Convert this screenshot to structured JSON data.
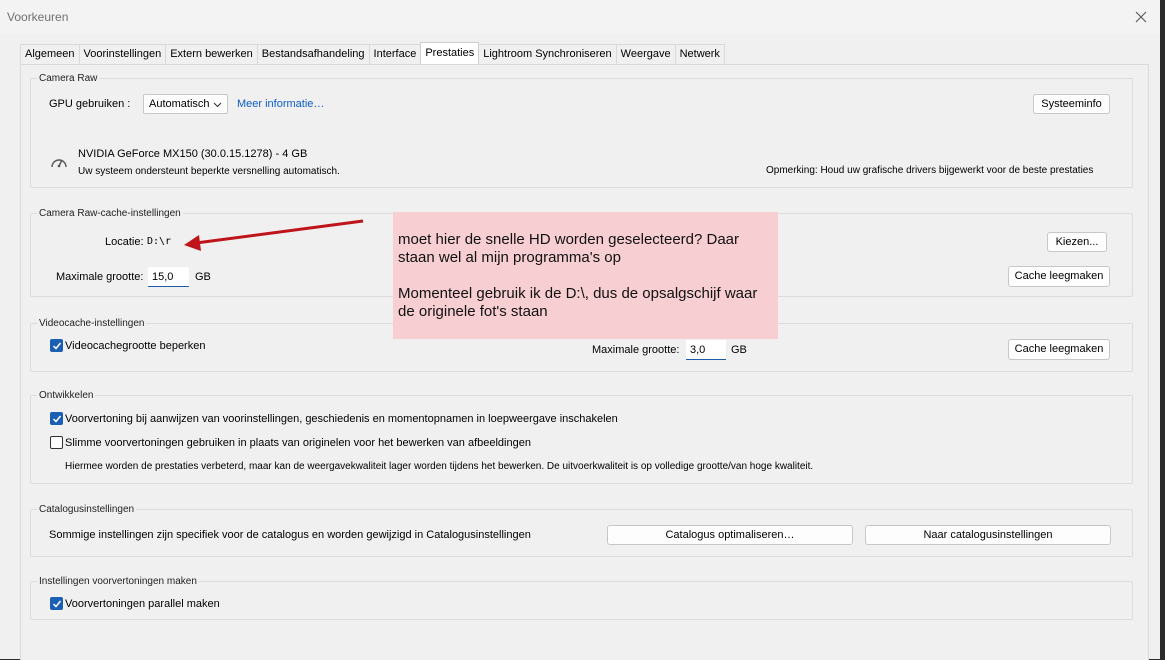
{
  "window": {
    "title": "Voorkeuren"
  },
  "tabs": [
    {
      "label": "Algemeen"
    },
    {
      "label": "Voorinstellingen"
    },
    {
      "label": "Extern bewerken"
    },
    {
      "label": "Bestandsafhandeling"
    },
    {
      "label": "Interface"
    },
    {
      "label": "Prestaties"
    },
    {
      "label": "Lightroom Synchroniseren"
    },
    {
      "label": "Weergave"
    },
    {
      "label": "Netwerk"
    }
  ],
  "active_tab": "Prestaties",
  "camera_raw": {
    "title": "Camera Raw",
    "gpu_label": "GPU gebruiken :",
    "gpu_value": "Automatisch",
    "more_info": "Meer informatie…",
    "system_info_button": "Systeeminfo",
    "gpu_name": "NVIDIA GeForce MX150 (30.0.15.1278) - 4 GB",
    "gpu_status": "Uw systeem ondersteunt beperkte versnelling automatisch.",
    "remark": "Opmerking: Houd uw grafische drivers bijgewerkt voor de beste prestaties"
  },
  "cache": {
    "title": "Camera Raw-cache-instellingen",
    "location_label": "Locatie:",
    "location_value": "D:\\r",
    "choose_button": "Kiezen...",
    "max_size_label": "Maximale grootte:",
    "max_size_value": "15,0",
    "unit": "GB",
    "clear_button": "Cache leegmaken"
  },
  "video_cache": {
    "title": "Videocache-instellingen",
    "limit_checkbox_label": "Videocachegrootte beperken",
    "limit_checked": true,
    "max_size_label": "Maximale grootte:",
    "max_size_value": "3,0",
    "unit": "GB",
    "clear_button": "Cache leegmaken"
  },
  "develop": {
    "title": "Ontwikkelen",
    "preview_hover_label": "Voorvertoning bij aanwijzen van voorinstellingen, geschiedenis en momentopnamen in loepweergave inschakelen",
    "preview_hover_checked": true,
    "smart_previews_label": "Slimme voorvertoningen gebruiken in plaats van originelen voor het bewerken van afbeeldingen",
    "smart_previews_checked": false,
    "smart_previews_note": "Hiermee worden de prestaties verbeterd, maar kan de weergavekwaliteit lager worden tijdens het bewerken. De uitvoerkwaliteit is op volledige grootte/van hoge kwaliteit."
  },
  "catalog": {
    "title": "Catalogusinstellingen",
    "description": "Sommige instellingen zijn specifiek voor de catalogus en worden gewijzigd in Catalogusinstellingen",
    "optimize_button": "Catalogus optimaliseren…",
    "settings_button": "Naar catalogusinstellingen"
  },
  "previews": {
    "title": "Instellingen voorvertoningen maken",
    "parallel_label": "Voorvertoningen parallel maken",
    "parallel_checked": true
  },
  "annotation": {
    "line1": "moet hier de snelle HD worden geselecteerd? Daar staan wel al mijn programma's op",
    "line2": "Momenteel gebruik ik de D:\\, dus de opsalgschijf waar de originele fot's staan",
    "arrow_color": "#c0141b",
    "note_color": "#f7cfd2"
  },
  "colors": {
    "accent": "#1a5fb4",
    "link": "#0c5cc5"
  }
}
